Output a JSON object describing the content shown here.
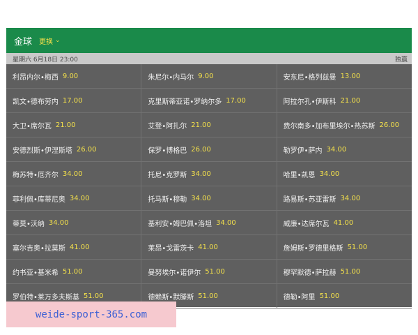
{
  "header": {
    "title": "金球",
    "switch_label": "更换"
  },
  "subbar": {
    "datetime": "星期六 6月18日 23:00",
    "right_label": "独赢"
  },
  "rows": [
    [
      {
        "name": "利昂内尔•梅西",
        "odds": "9.00"
      },
      {
        "name": "朱尼尔•内马尔",
        "odds": "9.00"
      },
      {
        "name": "安东尼•格列兹曼",
        "odds": "13.00"
      }
    ],
    [
      {
        "name": "凯文•德布劳内",
        "odds": "17.00"
      },
      {
        "name": "克里斯蒂亚诺•罗纳尔多",
        "odds": "17.00"
      },
      {
        "name": "阿拉尔孔•伊斯科",
        "odds": "21.00"
      }
    ],
    [
      {
        "name": "大卫•席尔瓦",
        "odds": "21.00"
      },
      {
        "name": "艾登•阿扎尔",
        "odds": "21.00"
      },
      {
        "name": "费尔南多•加布里埃尔•热苏斯",
        "odds": "26.00"
      }
    ],
    [
      {
        "name": "安德烈斯•伊涅斯塔",
        "odds": "26.00"
      },
      {
        "name": "保罗•博格巴",
        "odds": "26.00"
      },
      {
        "name": "勒罗伊•萨内",
        "odds": "34.00"
      }
    ],
    [
      {
        "name": "梅苏特•厄齐尔",
        "odds": "34.00"
      },
      {
        "name": "托尼•克罗斯",
        "odds": "34.00"
      },
      {
        "name": "哈里•凯恩",
        "odds": "34.00"
      }
    ],
    [
      {
        "name": "菲利佩•库蒂尼奥",
        "odds": "34.00"
      },
      {
        "name": "托马斯•穆勒",
        "odds": "34.00"
      },
      {
        "name": "路易斯•苏亚雷斯",
        "odds": "34.00"
      }
    ],
    [
      {
        "name": "蒂莫•沃纳",
        "odds": "34.00"
      },
      {
        "name": "基利安•姆巴佩•洛坦",
        "odds": "34.00"
      },
      {
        "name": "威廉•达席尔瓦",
        "odds": "41.00"
      }
    ],
    [
      {
        "name": "塞尔吉奥•拉莫斯",
        "odds": "41.00"
      },
      {
        "name": "莱昂•戈雷茨卡",
        "odds": "41.00"
      },
      {
        "name": "詹姆斯•罗德里格斯",
        "odds": "51.00"
      }
    ],
    [
      {
        "name": "约书亚•基米希",
        "odds": "51.00"
      },
      {
        "name": "曼努埃尔•诺伊尔",
        "odds": "51.00"
      },
      {
        "name": "穆罕默德•萨拉赫",
        "odds": "51.00"
      }
    ],
    [
      {
        "name": "罗伯特•莱万多夫斯基",
        "odds": "51.00"
      },
      {
        "name": "德赖斯•默滕斯",
        "odds": "51.00"
      },
      {
        "name": "德勒•阿里",
        "odds": "51.00"
      }
    ]
  ],
  "watermark": {
    "text": "weide-sport-365.com"
  },
  "colors": {
    "header_bg": "#1a8a4a",
    "odds": "#f3e04b",
    "panel_bg": "#5f5f5f",
    "subbar_bg": "#c9c9c9",
    "watermark_bg": "#f6c9cf",
    "watermark_text": "#3b5fd4"
  }
}
